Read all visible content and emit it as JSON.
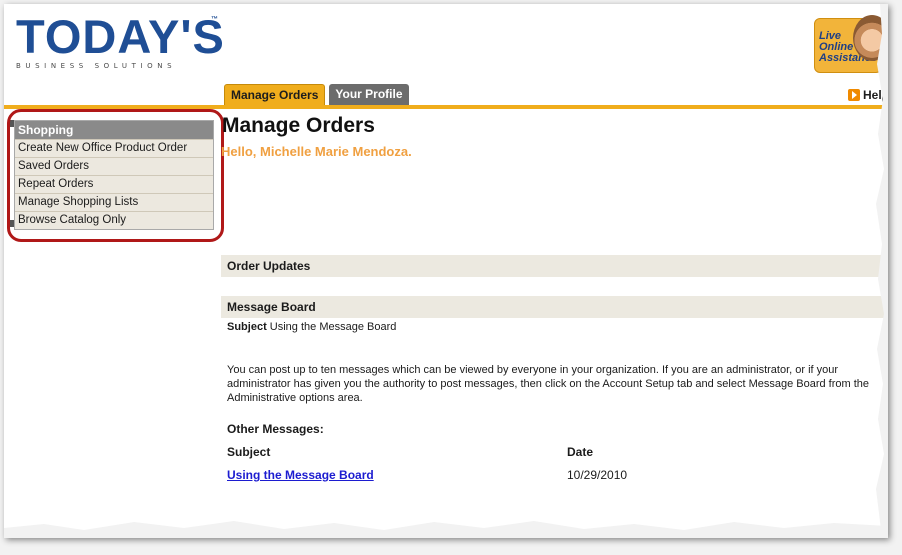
{
  "brand": {
    "logo_text": "TODAY'S",
    "logo_tm": "™",
    "logo_sub": "BUSINESS SOLUTIONS",
    "primary_color": "#1f4e95"
  },
  "assist": {
    "text": "Live\nOnline\nAssistance"
  },
  "tabs": [
    {
      "label": "Manage Orders",
      "active": true
    },
    {
      "label": "Your Profile",
      "active": false
    }
  ],
  "help": {
    "label": "Help",
    "icon": "play-icon"
  },
  "sidebar": {
    "header": "Shopping",
    "items": [
      {
        "label": "Create New Office Product Order"
      },
      {
        "label": "Saved Orders"
      },
      {
        "label": "Repeat Orders"
      },
      {
        "label": "Manage Shopping Lists"
      },
      {
        "label": "Browse Catalog Only"
      }
    ]
  },
  "main": {
    "title": "Manage Orders",
    "greeting": "Hello,  Michelle Marie Mendoza.",
    "order_updates": "Order Updates",
    "message_board": {
      "title": "Message Board",
      "subject_label": "Subject",
      "subject_value": "Using the Message Board",
      "body": "You can post up to ten messages which can be viewed by everyone in your organization. If you are an administrator, or if your administrator has given you the authority to post messages, then click on the Account Setup tab and select Message Board from the Administrative options area.",
      "other_title": "Other Messages:",
      "columns": {
        "subject": "Subject",
        "date": "Date"
      },
      "rows": [
        {
          "subject": "Using the Message Board",
          "date": "10/29/2010"
        }
      ]
    }
  },
  "colors": {
    "accent": "#f0ad1c",
    "highlight": "#b01818",
    "greeting": "#f0a041",
    "link": "#1c1cd0"
  }
}
